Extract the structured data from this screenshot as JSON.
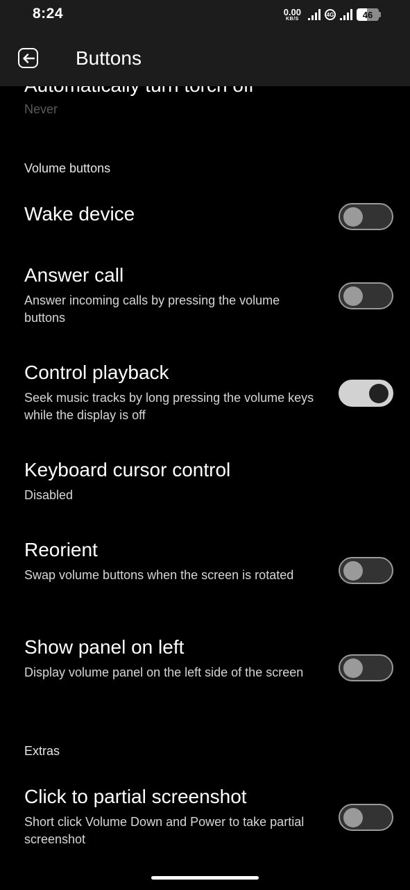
{
  "status": {
    "time": "8:24",
    "net_speed": "0.00",
    "net_unit": "KB/S",
    "network_type": "4G",
    "battery": "46",
    "battery_level": 0.46
  },
  "appbar": {
    "title": "Buttons",
    "back_icon": "back-arrow-icon"
  },
  "content": {
    "partial_item": {
      "title": "Automatically turn torch off",
      "subtitle": "Never"
    },
    "sections": [
      {
        "header": "Volume buttons",
        "items": [
          {
            "title": "Wake device",
            "subtitle": "",
            "toggle": "off"
          },
          {
            "title": "Answer call",
            "subtitle": "Answer incoming calls by pressing the volume buttons",
            "toggle": "off"
          },
          {
            "title": "Control playback",
            "subtitle": "Seek music tracks by long pressing the volume keys while the display is off",
            "toggle": "on"
          },
          {
            "title": "Keyboard cursor control",
            "subtitle": "Disabled"
          },
          {
            "title": "Reorient",
            "subtitle": "Swap volume buttons when the screen is rotated",
            "toggle": "off"
          },
          {
            "title": "Show panel on left",
            "subtitle": "Display volume panel on the left side of the screen",
            "toggle": "off"
          }
        ]
      },
      {
        "header": "Extras",
        "items": [
          {
            "title": "Click to partial screenshot",
            "subtitle": "Short click Volume Down and Power to take partial screenshot",
            "toggle": "off"
          }
        ]
      }
    ]
  },
  "colors": {
    "bar_bg": "#1c1c1c",
    "page_bg": "#000000",
    "toggle_on": "#d2d2d2",
    "toggle_off": "#333333"
  }
}
